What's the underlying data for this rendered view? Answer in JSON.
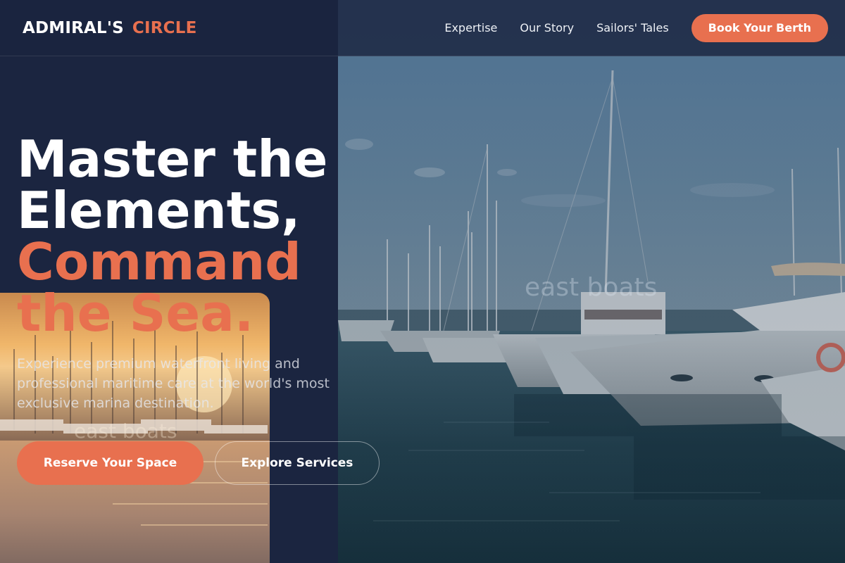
{
  "brand": {
    "name_part1": "ADMIRAL'S",
    "name_part2": "CIRCLE"
  },
  "nav": {
    "items": [
      "Expertise",
      "Our Story",
      "Sailors' Tales"
    ],
    "cta_label": "Book Your Berth"
  },
  "hero": {
    "title_line1": "Master the",
    "title_line2": "Elements,",
    "title_accent1": "Command",
    "title_accent2": "the Sea.",
    "subtitle": "Experience premium waterfront living and professional maritime care at the world's most exclusive marina destination.",
    "primary_label": "Reserve Your Space",
    "secondary_label": "Explore Services"
  },
  "images": {
    "harbor_alt_fragment": "east boats",
    "sunset_alt_fragment": "east boats"
  },
  "colors": {
    "accent": "#e8704f",
    "background": "#1b2540",
    "text": "#ffffff"
  }
}
